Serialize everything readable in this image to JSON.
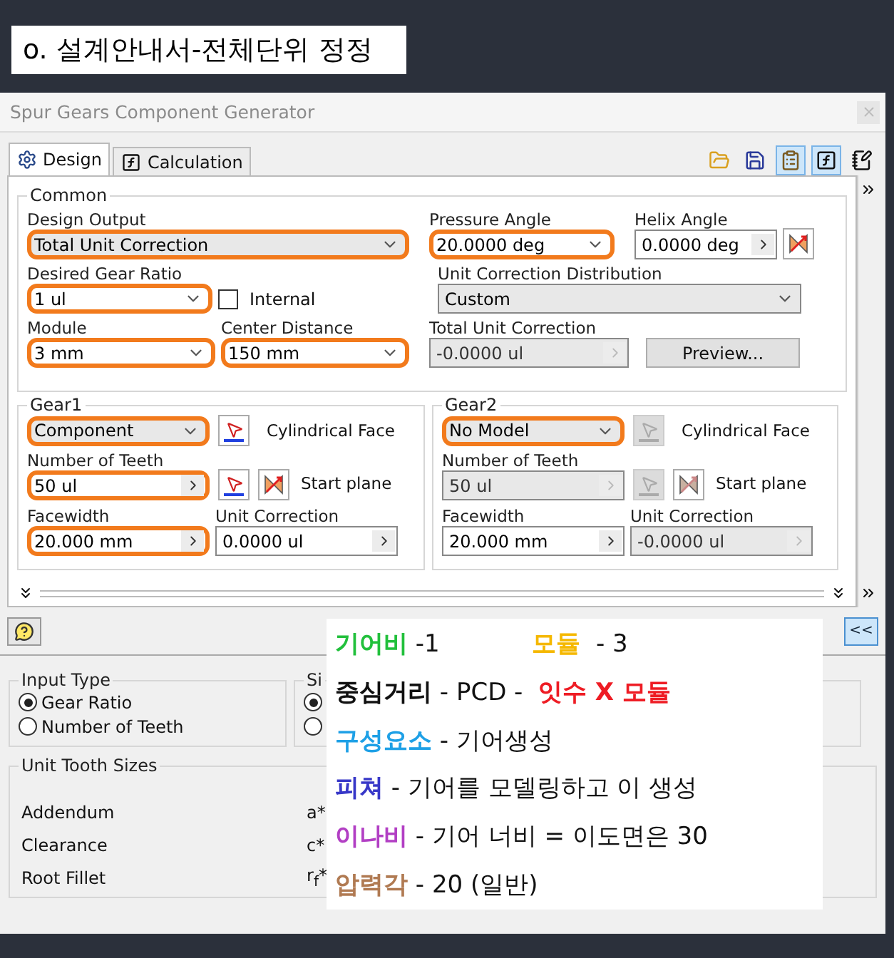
{
  "caption": "o. 설계안내서-전체단위 정정",
  "window": {
    "title": "Spur Gears Component Generator"
  },
  "tabs": [
    {
      "label": "Design",
      "kind": "design",
      "selected": true
    },
    {
      "label": "Calculation",
      "kind": "calculation",
      "selected": false
    }
  ],
  "common": {
    "legend": "Common",
    "design_output": {
      "label": "Design Output",
      "value": "Total Unit Correction",
      "kind": "select",
      "highlighted": true,
      "disabled": false
    },
    "pressure_angle": {
      "label": "Pressure Angle",
      "value": "20.0000 deg",
      "kind": "combo",
      "highlighted": true,
      "disabled": false
    },
    "helix_angle": {
      "label": "Helix Angle",
      "value": "0.0000 deg",
      "kind": "spin",
      "highlighted": false,
      "disabled": false
    },
    "gear_ratio": {
      "label": "Desired Gear Ratio",
      "value": "1 ul",
      "kind": "combo",
      "highlighted": true,
      "disabled": false
    },
    "internal": {
      "label": "Internal",
      "checked": false
    },
    "distribution": {
      "label": "Unit Correction Distribution",
      "value": "Custom",
      "kind": "select",
      "highlighted": false,
      "disabled": false
    },
    "module": {
      "label": "Module",
      "value": "3 mm",
      "kind": "combo",
      "highlighted": true,
      "disabled": false
    },
    "center_distance": {
      "label": "Center Distance",
      "value": "150 mm",
      "kind": "combo",
      "highlighted": true,
      "disabled": false
    },
    "total_unit_correction": {
      "label": "Total Unit Correction",
      "value": "-0.0000 ul",
      "kind": "spin",
      "highlighted": false,
      "disabled": true
    },
    "preview_button": "Preview..."
  },
  "gears": [
    {
      "legend": "Gear1",
      "picks_enabled": true,
      "model": {
        "value": "Component",
        "kind": "select",
        "highlighted": true,
        "disabled": false
      },
      "cylindrical_face": "Cylindrical Face",
      "teeth": {
        "label": "Number of Teeth",
        "value": "50 ul",
        "kind": "spin",
        "highlighted": true,
        "disabled": false
      },
      "start_plane": "Start plane",
      "facewidth": {
        "label": "Facewidth",
        "value": "20.000 mm",
        "kind": "spin",
        "highlighted": true,
        "disabled": false
      },
      "unit_correction": {
        "label": "Unit Correction",
        "value": "0.0000 ul",
        "kind": "spin",
        "highlighted": false,
        "disabled": false
      }
    },
    {
      "legend": "Gear2",
      "picks_enabled": false,
      "model": {
        "value": "No Model",
        "kind": "select",
        "highlighted": true,
        "disabled": false
      },
      "cylindrical_face": "Cylindrical Face",
      "teeth": {
        "label": "Number of Teeth",
        "value": "50 ul",
        "kind": "spin",
        "highlighted": false,
        "disabled": true
      },
      "start_plane": "Start plane",
      "facewidth": {
        "label": "Facewidth",
        "value": "20.000 mm",
        "kind": "spin",
        "highlighted": false,
        "disabled": false
      },
      "unit_correction": {
        "label": "Unit Correction",
        "value": "-0.0000 ul",
        "kind": "spin",
        "highlighted": false,
        "disabled": true
      }
    }
  ],
  "back_button": "<<",
  "input_type": {
    "legend": "Input Type",
    "options": [
      {
        "label": "Gear Ratio",
        "selected": true
      },
      {
        "label": "Number of Teeth",
        "selected": false
      }
    ]
  },
  "size_group": {
    "legend": "Si",
    "options": [
      {
        "selected": true
      },
      {
        "selected": false
      }
    ]
  },
  "unit_tooth_sizes": {
    "legend": "Unit Tooth Sizes",
    "rows": [
      {
        "label": "Addendum",
        "symbol": "a*"
      },
      {
        "label": "Clearance",
        "symbol": "c*"
      },
      {
        "label": "Root Fillet",
        "symbol": "r$_{f}$*"
      }
    ]
  },
  "note": {
    "lines": [
      {
        "parts": [
          {
            "kind": "term",
            "text": "기어비",
            "color": "#22c03c"
          },
          {
            "kind": "text",
            "text": " -1            "
          },
          {
            "kind": "term",
            "text": "모듈",
            "color": "#f5b800"
          },
          {
            "kind": "text",
            "text": "  - 3"
          }
        ]
      },
      {
        "parts": [
          {
            "kind": "term",
            "text": "중심거리",
            "color": "#111111"
          },
          {
            "kind": "text",
            "text": " - PCD -  "
          },
          {
            "kind": "term",
            "text": "잇수 X 모듈",
            "color": "#ee1c24"
          }
        ]
      },
      {
        "parts": [
          {
            "kind": "term",
            "text": "구성요소",
            "color": "#1ea0e6"
          },
          {
            "kind": "text",
            "text": " - 기어생성"
          }
        ]
      },
      {
        "parts": [
          {
            "kind": "term",
            "text": "피쳐",
            "color": "#3838c8"
          },
          {
            "kind": "text",
            "text": " - 기어를 모델링하고 이 생성"
          }
        ]
      },
      {
        "parts": [
          {
            "kind": "term",
            "text": "이나비",
            "color": "#b23fc4"
          },
          {
            "kind": "text",
            "text": " - 기어 너비 = 이도면은 30"
          }
        ]
      },
      {
        "parts": [
          {
            "kind": "term",
            "text": "압력각",
            "color": "#b07a52"
          },
          {
            "kind": "text",
            "text": " - 20 (일반)"
          }
        ]
      }
    ]
  }
}
